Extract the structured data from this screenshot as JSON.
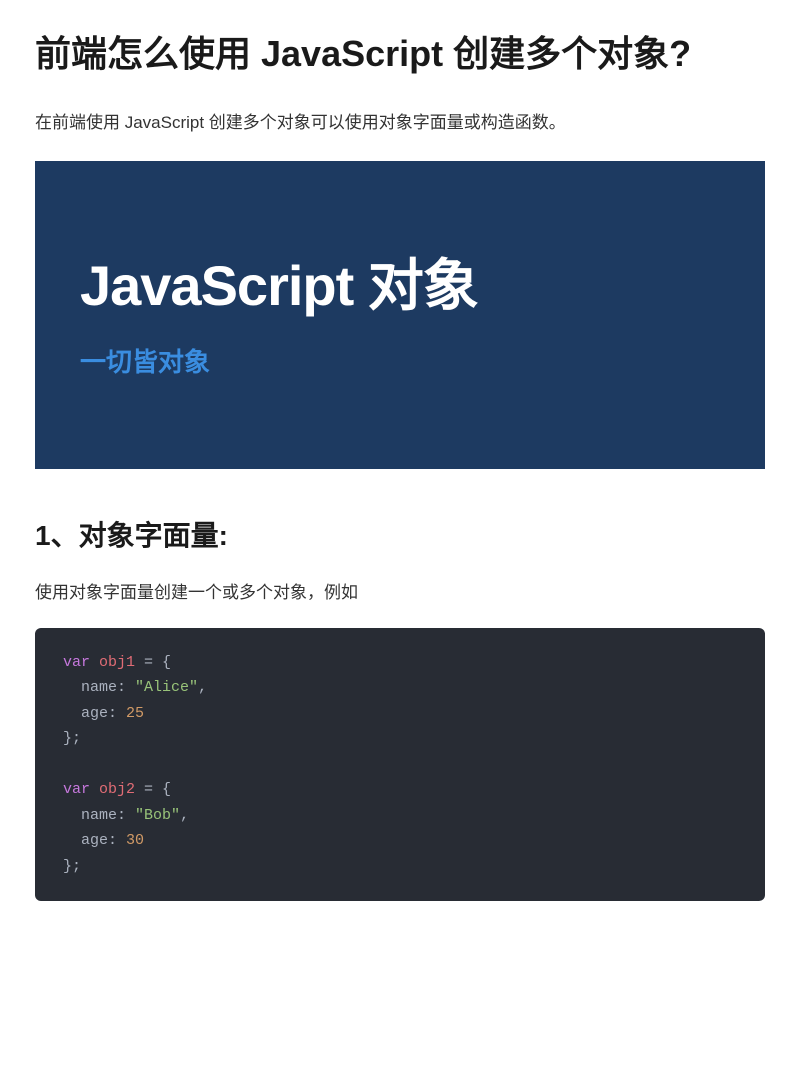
{
  "page_title": "前端怎么使用 JavaScript 创建多个对象?",
  "intro_text": "在前端使用 JavaScript 创建多个对象可以使用对象字面量或构造函数。",
  "banner": {
    "title": "JavaScript 对象",
    "subtitle": "一切皆对象"
  },
  "section1": {
    "heading": "1、对象字面量:",
    "text": "使用对象字面量创建一个或多个对象，例如"
  },
  "code": {
    "kw_var1": "var",
    "var_obj1": "obj1",
    "eq1": " = {",
    "prop_name1": "name",
    "colon1": ": ",
    "val_name1": "\"Alice\"",
    "comma1": ",",
    "prop_age1": "age",
    "colon2": ": ",
    "val_age1": "25",
    "close1": "};",
    "kw_var2": "var",
    "var_obj2": "obj2",
    "eq2": " = {",
    "prop_name2": "name",
    "colon3": ": ",
    "val_name2": "\"Bob\"",
    "comma2": ",",
    "prop_age2": "age",
    "colon4": ": ",
    "val_age2": "30",
    "close2": "};"
  }
}
